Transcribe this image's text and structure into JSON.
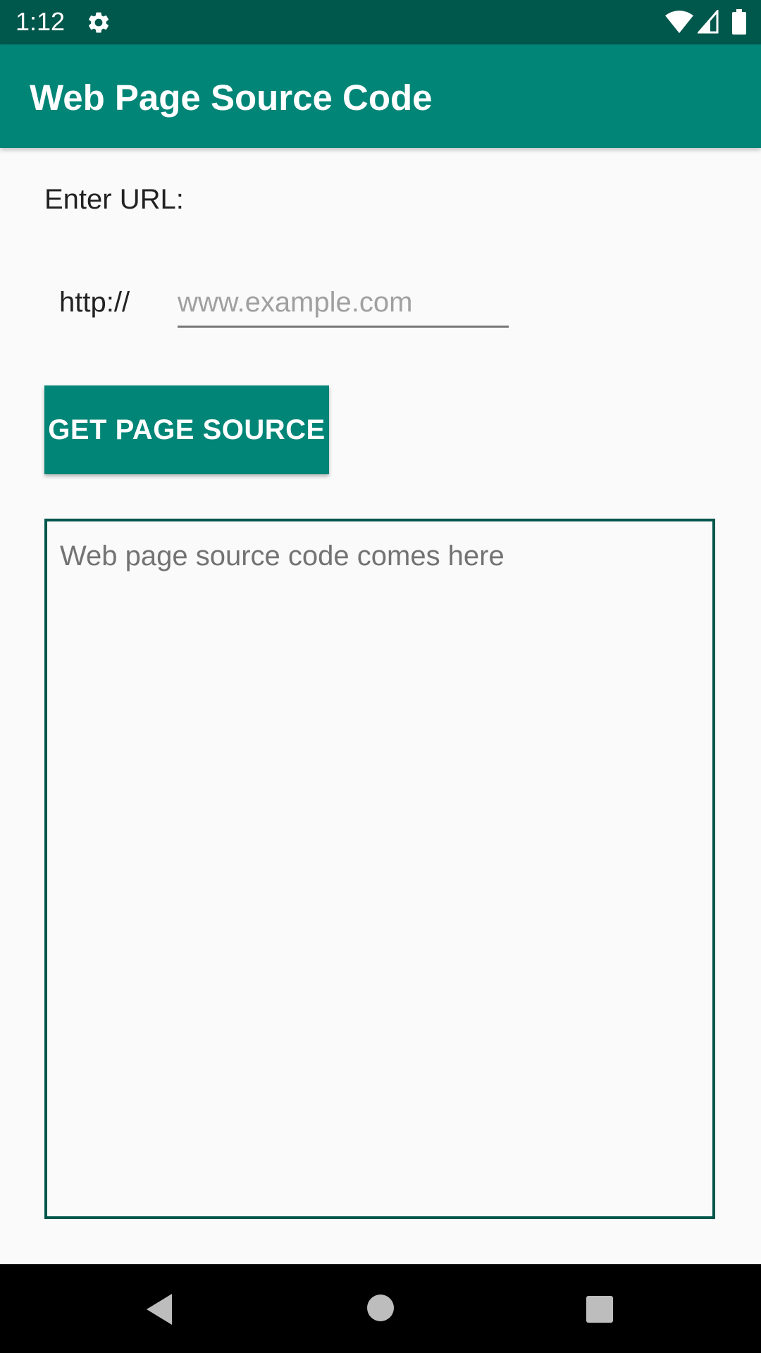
{
  "status_bar": {
    "time": "1:12",
    "icons": [
      "gear-icon",
      "wifi-icon",
      "signal-icon",
      "battery-icon"
    ]
  },
  "app_bar": {
    "title": "Web Page Source Code"
  },
  "form": {
    "enter_url_label": "Enter URL:",
    "scheme_label": "http://",
    "url_input": {
      "value": "",
      "placeholder": "www.example.com"
    },
    "button_label": "GET PAGE SOURCE"
  },
  "output": {
    "placeholder": "Web page source code comes here"
  },
  "nav_bar": {
    "icons": [
      "back-icon",
      "home-icon",
      "recents-icon"
    ]
  },
  "colors": {
    "primary": "#008577",
    "primary_dark": "#00574b",
    "background": "#fafafa"
  }
}
